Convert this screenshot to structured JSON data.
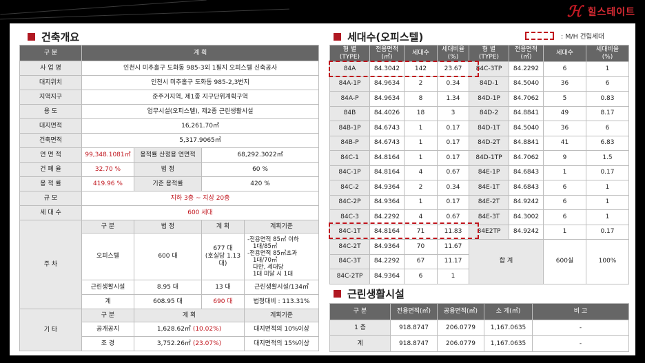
{
  "brand": {
    "name": "힐스테이트"
  },
  "legend": {
    "text": ": M/H 건립세대"
  },
  "building": {
    "title": "건축개요",
    "head": [
      "구 분",
      "계 획"
    ],
    "rows": [
      [
        "사 업 명",
        "인천시 미추홀구 도화동 985-3외 1필지 오피스텔 신축공사"
      ],
      [
        "대지위치",
        "인천시 미추홀구 도화동 985-2,3번지"
      ],
      [
        "지역지구",
        "준주거지역, 제1종 지구단위계획구역"
      ],
      [
        "용 도",
        "업무시설(오피스텔), 제2종 근린생활시설"
      ],
      [
        "대지면적",
        "16,261.70㎡"
      ],
      [
        "건축면적",
        "5,317.9065㎡"
      ]
    ],
    "floor_area": {
      "label": "연 면 적",
      "value": "99,348.1081㎡",
      "sub_label": "용적률 산정용 연면적",
      "sub_value": "68,292.3022㎡"
    },
    "coverage": {
      "label": "건 폐 율",
      "value": "32.70 %",
      "sub_label": "법 정",
      "sub_value": "60 %"
    },
    "far": {
      "label": "용 적 률",
      "value": "419.96 %",
      "sub_label": "기준 용적률",
      "sub_value": "420 %"
    },
    "scale": {
      "label": "규 모",
      "value": "지하 3층 ~ 지상 20층"
    },
    "units": {
      "label": "세 대 수",
      "value": "600 세대"
    },
    "parking": {
      "label": "주 차",
      "head": [
        "구 분",
        "법 정",
        "계 획",
        "계획기준"
      ],
      "office": {
        "name": "오피스텔",
        "legal": "600 대",
        "plan_1": "677 대",
        "plan_2": "(호실당 1.13대)",
        "std": [
          "-전용면적 85㎡ 이하",
          "1대/85㎡",
          "-전용면적 85㎡초과",
          "1대/70㎡",
          "다만, 세대당",
          "1대 미달 시 1대"
        ]
      },
      "retail": {
        "name": "근린생활시설",
        "legal": "8.95 대",
        "plan": "13 대",
        "std": "근린생활시설/134㎡"
      },
      "total": {
        "name": "계",
        "legal": "608.95 대",
        "plan": "690 대",
        "std": "법정대비 : 113.31%"
      }
    },
    "etc": {
      "label": "기 타",
      "head": [
        "구 분",
        "계 획",
        "계획기준"
      ],
      "rows": [
        {
          "name": "공개공지",
          "value": "1,628.62㎡",
          "pct": "(10.02%)",
          "std": "대지면적의 10%이상"
        },
        {
          "name": "조 경",
          "value": "3,752.26㎡",
          "pct": "(23.07%)",
          "std": "대지면적의 15%이상"
        }
      ]
    }
  },
  "units_table": {
    "title": "세대수(오피스텔)",
    "head": [
      {
        "a": "형 별",
        "b": "(TYPE)"
      },
      {
        "a": "전용면적",
        "b": "(㎡)"
      },
      {
        "a": "세대수",
        "b": ""
      },
      {
        "a": "세대비율",
        "b": "(%)"
      },
      {
        "a": "형 별",
        "b": "(TYPE)"
      },
      {
        "a": "전용면적",
        "b": "(㎡)"
      },
      {
        "a": "세대수",
        "b": ""
      },
      {
        "a": "세대비율",
        "b": "(%)"
      }
    ],
    "rows": [
      [
        "84A",
        "84.3042",
        "142",
        "23.67",
        "84C-3TP",
        "84.2292",
        "6",
        "1"
      ],
      [
        "84A-1P",
        "84.9634",
        "2",
        "0.34",
        "84D-1",
        "84.5040",
        "36",
        "6"
      ],
      [
        "84A-P",
        "84.9634",
        "8",
        "1.34",
        "84D-1P",
        "84.7062",
        "5",
        "0.83"
      ],
      [
        "84B",
        "84.4026",
        "18",
        "3",
        "84D-2",
        "84.8841",
        "49",
        "8.17"
      ],
      [
        "84B-1P",
        "84.6743",
        "1",
        "0.17",
        "84D-1T",
        "84.5040",
        "36",
        "6"
      ],
      [
        "84B-P",
        "84.6743",
        "1",
        "0.17",
        "84D-2T",
        "84.8841",
        "41",
        "6.83"
      ],
      [
        "84C-1",
        "84.8164",
        "1",
        "0.17",
        "84D-1TP",
        "84.7062",
        "9",
        "1.5"
      ],
      [
        "84C-1P",
        "84.8164",
        "4",
        "0.67",
        "84E-1P",
        "84.6843",
        "1",
        "0.17"
      ],
      [
        "84C-2",
        "84.9364",
        "2",
        "0.34",
        "84E-1T",
        "84.6843",
        "6",
        "1"
      ],
      [
        "84C-2P",
        "84.9364",
        "1",
        "0.17",
        "84E-2T",
        "84.9242",
        "6",
        "1"
      ],
      [
        "84C-3",
        "84.2292",
        "4",
        "0.67",
        "84E-3T",
        "84.3002",
        "6",
        "1"
      ],
      [
        "84C-1T",
        "84.8164",
        "71",
        "11.83",
        "84E2TP",
        "84.9242",
        "1",
        "0.17"
      ]
    ],
    "tail_rows": [
      [
        "84C-2T",
        "84.9364",
        "70",
        "11.67"
      ],
      [
        "84C-3T",
        "84.2292",
        "67",
        "11.17"
      ],
      [
        "84C-2TP",
        "84.9364",
        "6",
        "1"
      ]
    ],
    "total": {
      "label": "합 계",
      "units": "600실",
      "ratio": "100%"
    }
  },
  "retail": {
    "title": "근린생활시설",
    "head": [
      "구 분",
      "전용면적(㎡)",
      "공용면적(㎡)",
      "소 계(㎡)",
      "비 고"
    ],
    "rows": [
      [
        "1 층",
        "918.8747",
        "206.0779",
        "1,167.0635",
        "-"
      ],
      [
        "계",
        "918.8747",
        "206.0779",
        "1,167.0635",
        "-"
      ]
    ]
  }
}
